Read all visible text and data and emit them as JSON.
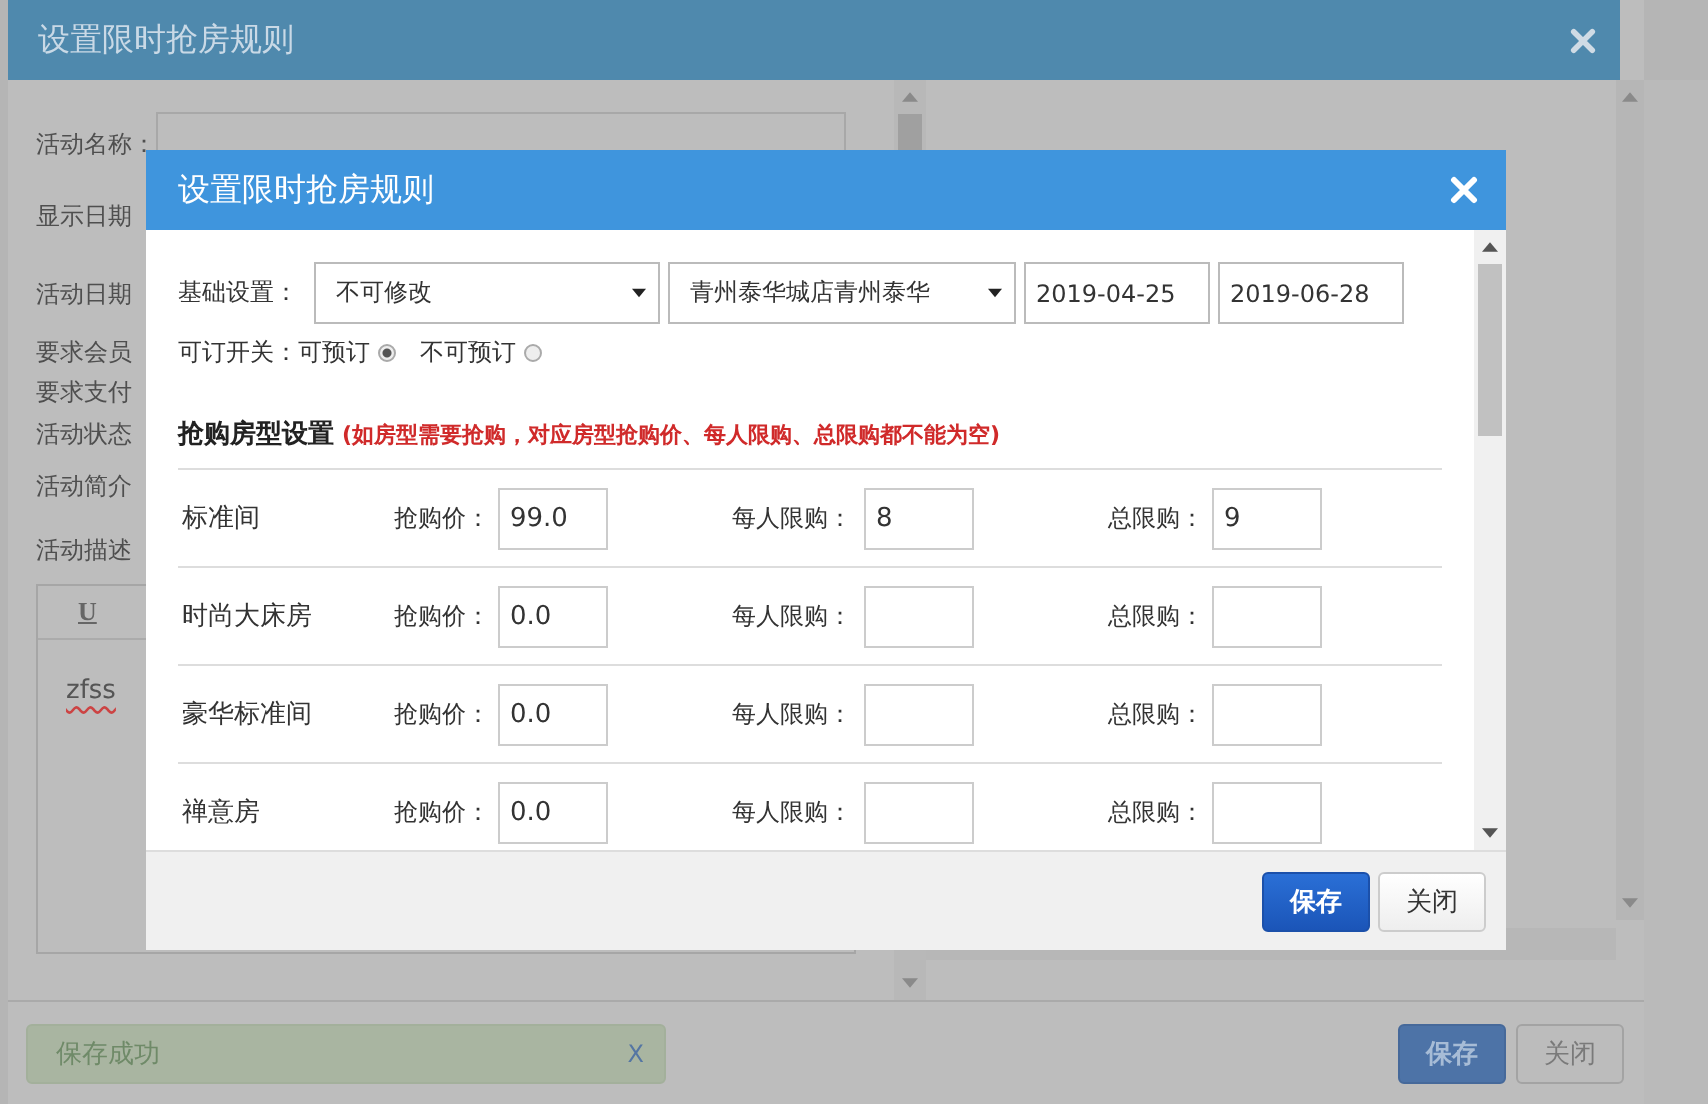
{
  "background_dialog": {
    "title": "设置限时抢房规则",
    "name_label": "活动名称：",
    "form_labels": [
      "显示日期",
      "活动日期",
      "要求会员",
      "要求支付",
      "活动状态",
      "活动简介",
      "活动描述"
    ],
    "editor": {
      "toolbar_button": "U",
      "content": "zfss"
    },
    "toast": {
      "message": "保存成功",
      "close": "X"
    },
    "buttons": [
      "保存",
      "关闭"
    ]
  },
  "dialog": {
    "title": "设置限时抢房规则",
    "basic": {
      "label": "基础设置：",
      "mode": "不可修改",
      "hotel": "青州泰华城店青州泰华",
      "start_date": "2019-04-25",
      "end_date": "2019-06-28"
    },
    "booking": {
      "label": "可订开关：",
      "options": [
        {
          "label": "可预订",
          "selected": true
        },
        {
          "label": "不可预订",
          "selected": false
        }
      ]
    },
    "section": {
      "title": "抢购房型设置",
      "note": "(如房型需要抢购，对应房型抢购价、每人限购、总限购都不能为空)"
    },
    "rooms": [
      {
        "name": "标准间",
        "price_label": "抢购价：",
        "price": "99.0",
        "per_person_label": "每人限购：",
        "per_person": "8",
        "total_label": "总限购：",
        "total": "9"
      },
      {
        "name": "时尚大床房",
        "price_label": "抢购价：",
        "price": "0.0",
        "per_person_label": "每人限购：",
        "total_label": "总限购："
      },
      {
        "name": "豪华标准间",
        "price_label": "抢购价：",
        "price": "0.0",
        "per_person_label": "每人限购：",
        "total_label": "总限购："
      },
      {
        "name": "禅意房",
        "price_label": "抢购价：",
        "price": "0.0",
        "per_person_label": "每人限购：",
        "total_label": "总限购："
      }
    ],
    "buttons": [
      {
        "label": "保存",
        "kind": "primary"
      },
      {
        "label": "关闭",
        "kind": "default"
      }
    ]
  }
}
